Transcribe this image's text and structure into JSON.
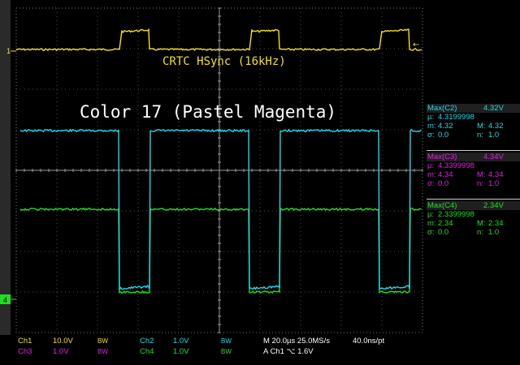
{
  "channels": {
    "ch1": {
      "color": "#f0e020"
    },
    "ch2": {
      "color": "#22d8e8"
    },
    "ch3": {
      "color": "#e020e0"
    },
    "ch4": {
      "color": "#20e020"
    }
  },
  "markers": {
    "ch1_ref": "1",
    "ch4_ref": "4",
    "trigger_arrow": "←"
  },
  "annotations": {
    "hsync": "CRTC HSync (16kHz)",
    "color_label": "Color 17 (Pastel Magenta)"
  },
  "measurements": [
    {
      "label": "Max(C2)",
      "value": "4.32V",
      "mean_label": "µ:",
      "mean": "4.3199998",
      "min_label": "m:",
      "min": "4.32",
      "max_label": "M:",
      "max": "4.32",
      "sd_label": "σ:",
      "sd": "0.0",
      "n_label": "n:",
      "n": "1.0",
      "color": "#22d8e8"
    },
    {
      "label": "Max(C3)",
      "value": "4.34V",
      "mean_label": "µ:",
      "mean": "4.3399998",
      "min_label": "m:",
      "min": "4.34",
      "max_label": "M:",
      "max": "4.34",
      "sd_label": "σ:",
      "sd": "0.0",
      "n_label": "n:",
      "n": "1.0",
      "color": "#e020e0"
    },
    {
      "label": "Max(C4)",
      "value": "2.34V",
      "mean_label": "µ:",
      "mean": "2.3399998",
      "min_label": "m:",
      "min": "2.34",
      "max_label": "M:",
      "max": "2.34",
      "sd_label": "σ:",
      "sd": "0.0",
      "n_label": "n:",
      "n": "1.0",
      "color": "#20e020"
    }
  ],
  "bottom_bar": {
    "ch1_label": "Ch1",
    "ch1_scale": "10.0V",
    "ch2_label": "Ch2",
    "ch2_scale": "1.0V",
    "ch3_label": "Ch3",
    "ch3_scale": "1.0V",
    "ch4_label": "Ch4",
    "ch4_scale": "1.0V",
    "bw": "BW",
    "timebase": "M 20.0µs 25.0MS/s",
    "sample_interval": "40.0ns/pt",
    "trigger": "A  Ch1  ⌥  1.6V"
  }
}
